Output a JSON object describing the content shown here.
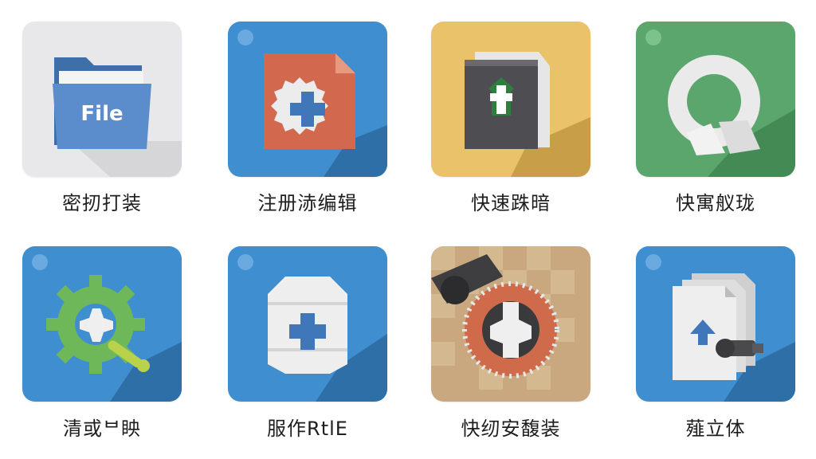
{
  "apps": [
    {
      "label": "密扨打装",
      "icon": "folder-icon",
      "icon_text": "File",
      "bg": "#e8e8ea"
    },
    {
      "label": "注册浾编辑",
      "icon": "document-plus-icon",
      "bg": "#3f8fd0"
    },
    {
      "label": "快速跦暗",
      "icon": "book-plus-icon",
      "bg": "#e9c26a"
    },
    {
      "label": "快寓舣珑",
      "icon": "ring-icon",
      "bg": "#5aa66c"
    },
    {
      "label": "清或ᄇ眏",
      "icon": "gear-wrench-icon",
      "bg": "#3f8fd0"
    },
    {
      "label": "服作RtlE",
      "icon": "shield-plus-icon",
      "bg": "#3f8fd0"
    },
    {
      "label": "快纫安馥装",
      "icon": "dial-icon",
      "bg": "#c9a87f"
    },
    {
      "label": "薤立体",
      "icon": "files-upload-icon",
      "bg": "#3f8fd0"
    }
  ]
}
